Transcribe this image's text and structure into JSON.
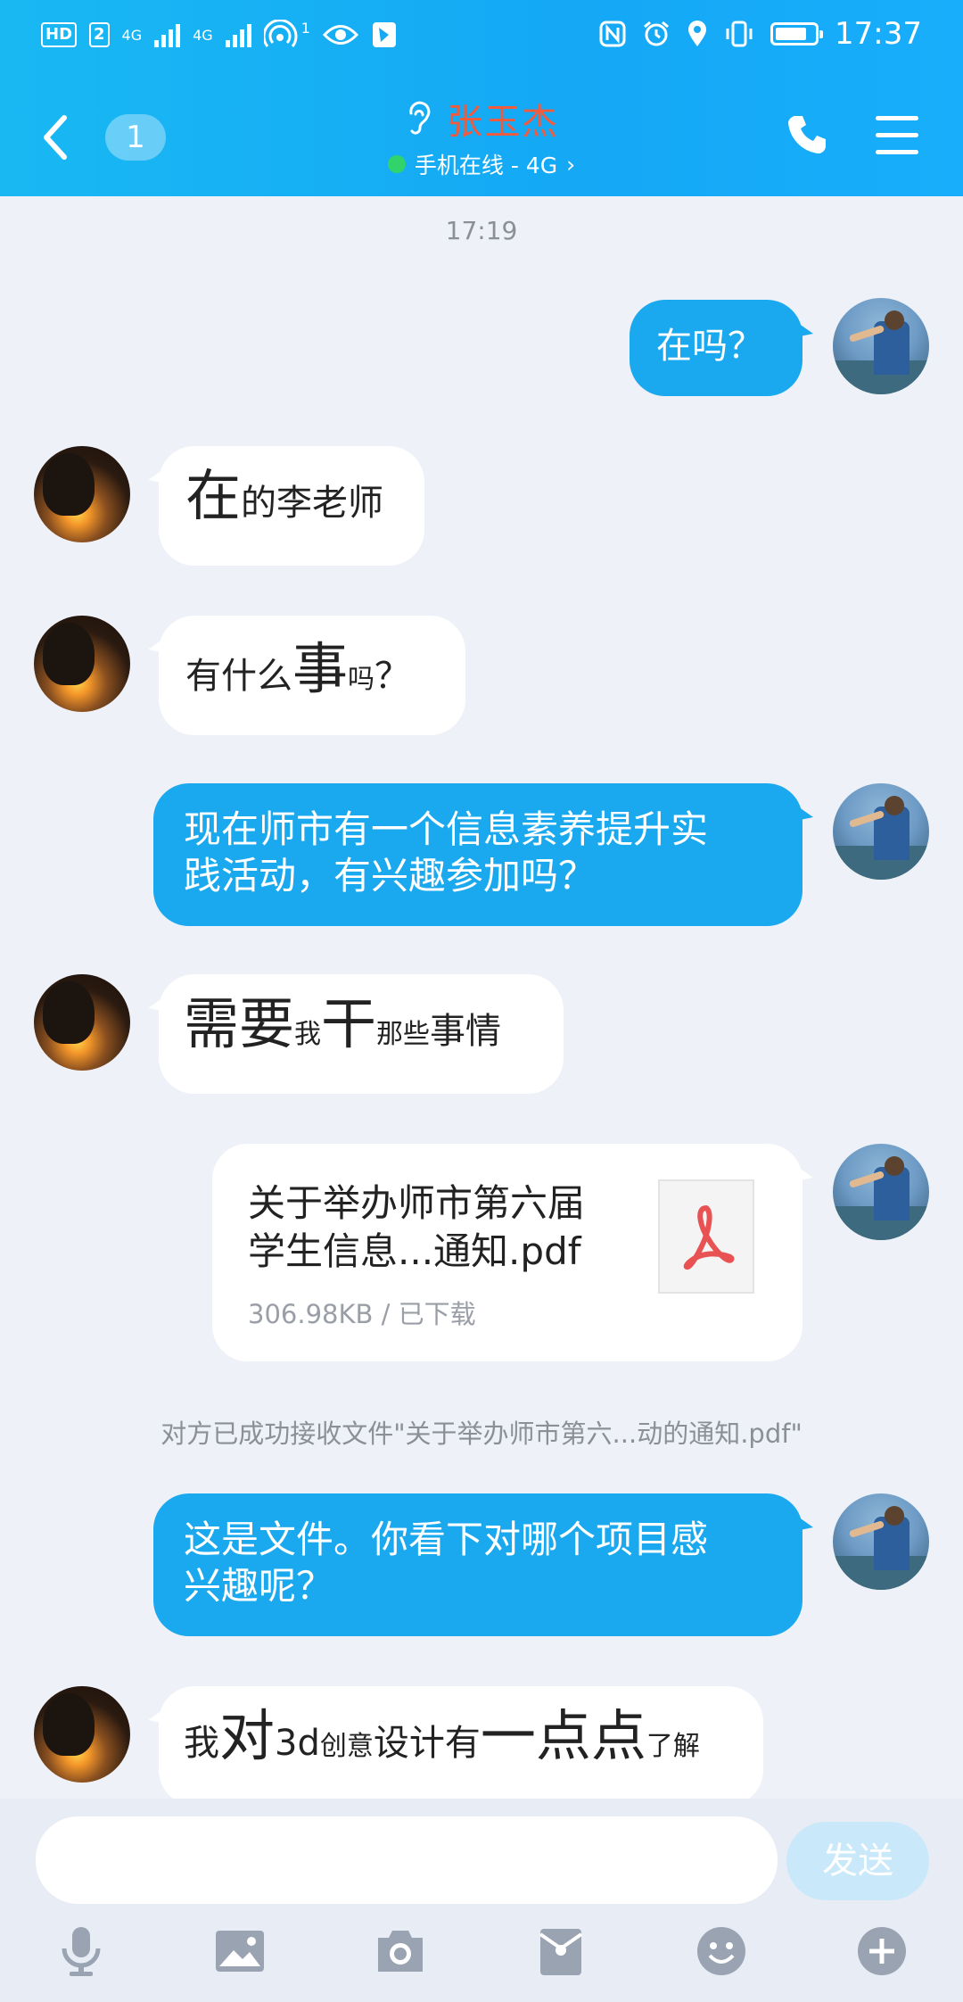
{
  "status_bar": {
    "left_chip": "HD",
    "left_chip2": "2",
    "net1": "4G",
    "net2": "4G",
    "hotspot_count": "1",
    "time": "17:37"
  },
  "nav": {
    "unread_count": "1",
    "contact_name": "张玉杰",
    "status": "手机在线 - 4G",
    "status_chevron": "›"
  },
  "chat": {
    "timestamp": "17:19",
    "messages": [
      {
        "text": "在吗？"
      },
      {
        "parts": [
          "在",
          "的李老师"
        ]
      },
      {
        "parts": [
          "有什么",
          "事",
          "吗",
          "？"
        ]
      },
      {
        "text": "现在师市有一个信息素养提升实践活动，有兴趣参加吗？",
        "line1": "现在师市有一个信息素养提升实",
        "line2": "践活动，有兴趣参加吗？"
      },
      {
        "parts": [
          "需要",
          "我",
          "干",
          "那些",
          "事情"
        ]
      },
      {
        "file_name_line1": "关于举办师市第六届",
        "file_name_line2": "学生信息...通知.pdf",
        "file_meta": "306.98KB / 已下载"
      },
      {
        "notice": "对方已成功接收文件\"关于举办师市第六...动的通知.pdf\""
      },
      {
        "line1": "这是文件。你看下对哪个项目感",
        "line2": "兴趣呢？"
      },
      {
        "parts": [
          "我",
          "对",
          "3d",
          "创意",
          "设计有",
          "一",
          "点点",
          "了解"
        ]
      }
    ]
  },
  "composer": {
    "input_value": "",
    "send_label": "发送"
  },
  "colors": {
    "header": "#14a8f5",
    "outgoing_bubble": "#1aa8ee",
    "contact_name": "#f25a3c",
    "online_dot": "#31d46a"
  },
  "icons": [
    "back-icon",
    "ear-icon",
    "phone-icon",
    "menu-icon",
    "pdf-icon",
    "microphone-icon",
    "image-icon",
    "camera-icon",
    "red-packet-icon",
    "emoji-icon",
    "plus-icon"
  ]
}
